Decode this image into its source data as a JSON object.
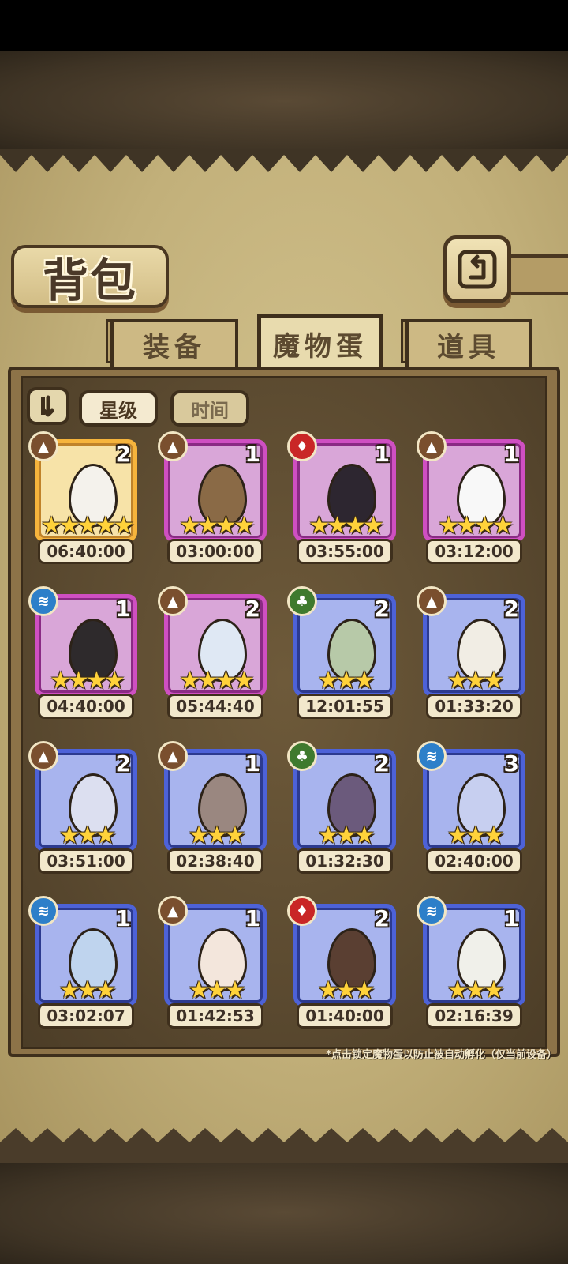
{
  "title": "背包",
  "tabs": [
    {
      "label": "装备"
    },
    {
      "label": "魔物蛋"
    },
    {
      "label": "道具"
    }
  ],
  "active_tab": "魔物蛋",
  "filters": {
    "star_label": "星级",
    "time_label": "时间"
  },
  "hint": "*点击锁定魔物蛋以防止被自动孵化（仅当前设备）",
  "eggs": [
    {
      "count": "2",
      "stars": "★★★★★",
      "timer": "06:40:00",
      "element": "earth",
      "rarity": "gold"
    },
    {
      "count": "1",
      "stars": "★★★★",
      "timer": "03:00:00",
      "element": "earth",
      "rarity": "purple"
    },
    {
      "count": "1",
      "stars": "★★★★",
      "timer": "03:55:00",
      "element": "fire",
      "rarity": "purple"
    },
    {
      "count": "1",
      "stars": "★★★★",
      "timer": "03:12:00",
      "element": "earth",
      "rarity": "purple"
    },
    {
      "count": "1",
      "stars": "★★★★",
      "timer": "04:40:00",
      "element": "water",
      "rarity": "purple"
    },
    {
      "count": "2",
      "stars": "★★★★",
      "timer": "05:44:40",
      "element": "earth",
      "rarity": "purple"
    },
    {
      "count": "2",
      "stars": "★★★",
      "timer": "12:01:55",
      "element": "grass",
      "rarity": "blue"
    },
    {
      "count": "2",
      "stars": "★★★",
      "timer": "01:33:20",
      "element": "earth",
      "rarity": "blue"
    },
    {
      "count": "2",
      "stars": "★★★",
      "timer": "03:51:00",
      "element": "earth",
      "rarity": "blue"
    },
    {
      "count": "1",
      "stars": "★★★",
      "timer": "02:38:40",
      "element": "earth",
      "rarity": "blue"
    },
    {
      "count": "2",
      "stars": "★★★",
      "timer": "01:32:30",
      "element": "grass",
      "rarity": "blue"
    },
    {
      "count": "3",
      "stars": "★★★",
      "timer": "02:40:00",
      "element": "water",
      "rarity": "blue"
    },
    {
      "count": "1",
      "stars": "★★★",
      "timer": "03:02:07",
      "element": "water",
      "rarity": "blue"
    },
    {
      "count": "1",
      "stars": "★★★",
      "timer": "01:42:53",
      "element": "earth",
      "rarity": "blue"
    },
    {
      "count": "2",
      "stars": "★★★",
      "timer": "01:40:00",
      "element": "fire",
      "rarity": "blue"
    },
    {
      "count": "1",
      "stars": "★★★",
      "timer": "02:16:39",
      "element": "water",
      "rarity": "blue"
    }
  ],
  "egg_art_colors": [
    "#f4f2ec",
    "#8a6a46",
    "#2d2630",
    "#f8f8f8",
    "#2e2a2c",
    "#dfe8f4",
    "#b7c9a8",
    "#f1ede4",
    "#dcdff0",
    "#9a8780",
    "#6b5a7c",
    "#c7cff0",
    "#bfd4ee",
    "#f3e6dc",
    "#5a3f32",
    "#f0f0ea"
  ],
  "element_icons": {
    "earth": "▲",
    "fire": "♦",
    "water": "≋",
    "grass": "♣"
  }
}
